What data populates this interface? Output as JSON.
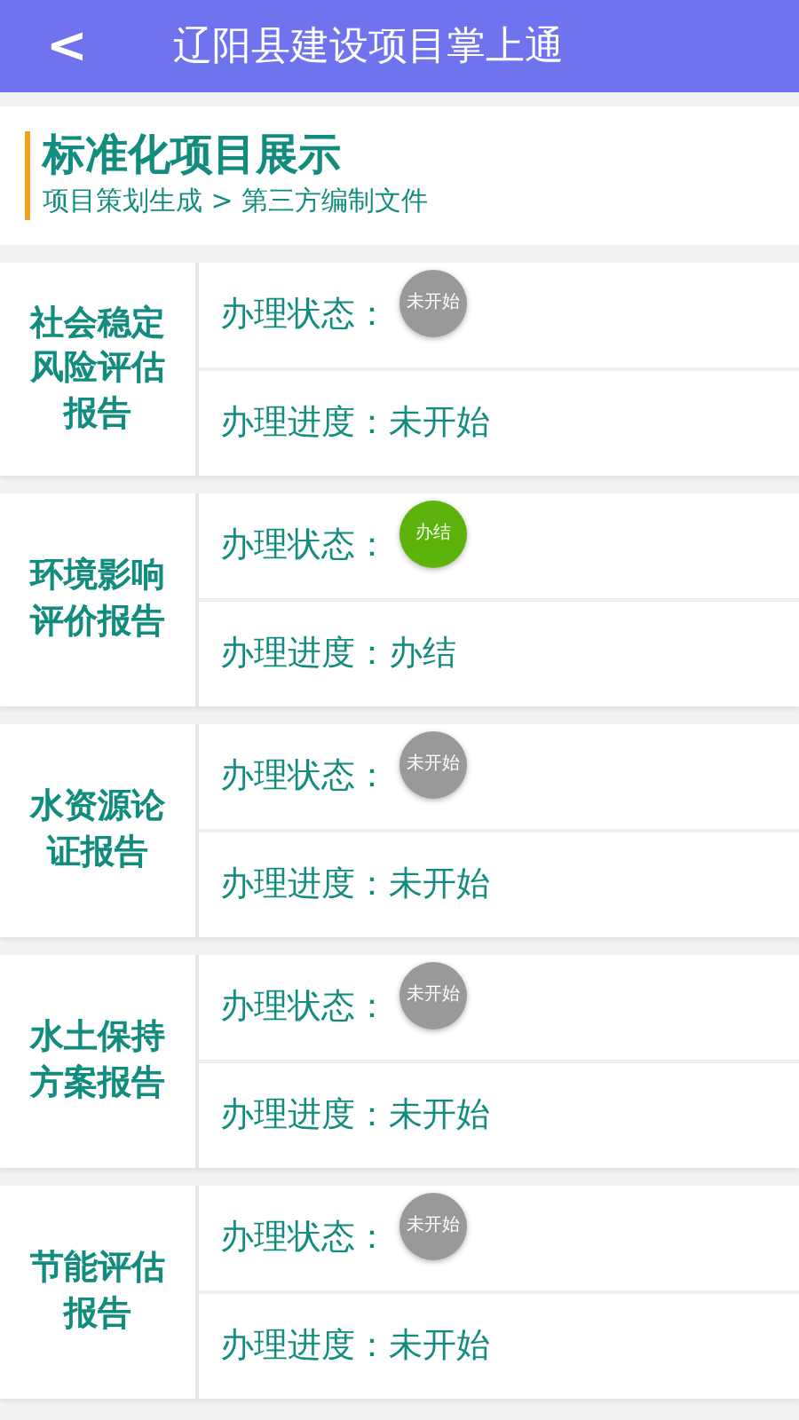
{
  "app_bar": {
    "back": "<",
    "title": "辽阳县建设项目掌上通"
  },
  "section": {
    "title": "标准化项目展示",
    "breadcrumb": "项目策划生成 > 第三方编制文件"
  },
  "items": [
    {
      "name": "社会稳定风险评估报告",
      "status_label": "办理状态：",
      "status": "未开始",
      "color": "#999999",
      "progress_label": "办理进度：",
      "progress": "未开始"
    },
    {
      "name": "环境影响评价报告",
      "status_label": "办理状态：",
      "status": "办结",
      "color": "#5cb30b",
      "progress_label": "办理进度：",
      "progress": "办结"
    },
    {
      "name": "水资源论证报告",
      "status_label": "办理状态：",
      "status": "未开始",
      "color": "#999999",
      "progress_label": "办理进度：",
      "progress": "未开始"
    },
    {
      "name": "水土保持方案报告",
      "status_label": "办理状态：",
      "status": "未开始",
      "color": "#999999",
      "progress_label": "办理进度：",
      "progress": "未开始"
    },
    {
      "name": "节能评估报告",
      "status_label": "办理状态：",
      "status": "未开始",
      "color": "#999999",
      "progress_label": "办理进度：",
      "progress": "未开始"
    }
  ]
}
